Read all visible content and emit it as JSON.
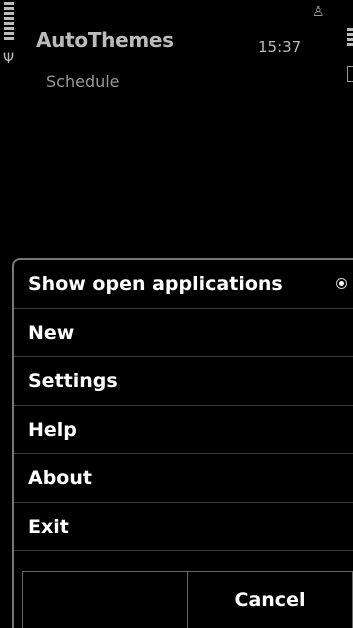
{
  "status": {
    "app_title": "AutoThemes",
    "time": "15:37",
    "subtitle": "Schedule"
  },
  "menu": {
    "items": [
      {
        "label": "Show open applications",
        "has_radio": true
      },
      {
        "label": "New"
      },
      {
        "label": "Settings"
      },
      {
        "label": "Help"
      },
      {
        "label": "About"
      },
      {
        "label": "Exit"
      }
    ]
  },
  "softkeys": {
    "left": "",
    "right": "Cancel"
  }
}
